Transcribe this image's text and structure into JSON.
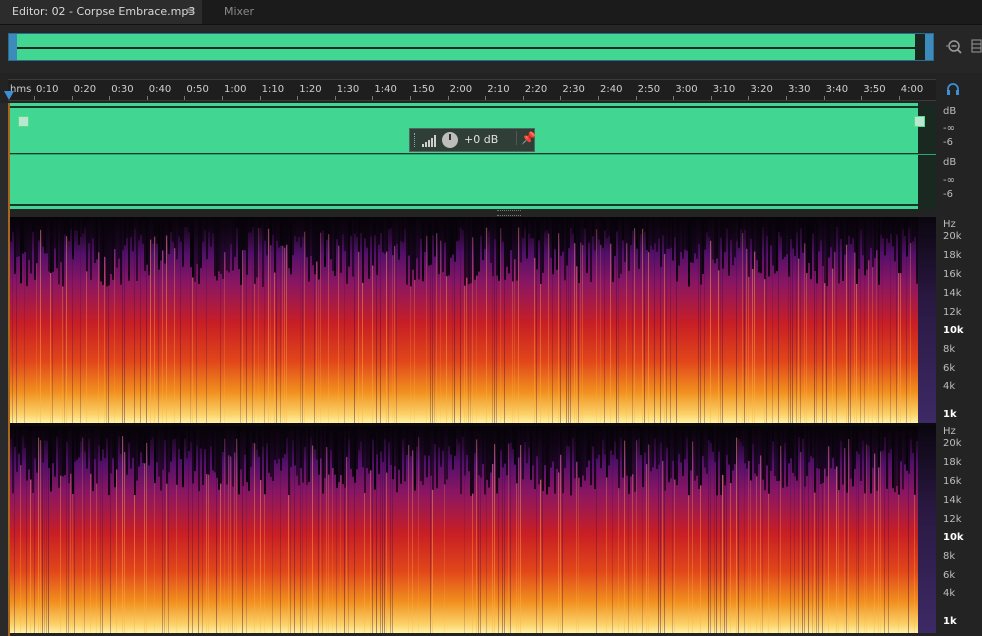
{
  "tabs": {
    "editor": "Editor: 02 - Corpse Embrace.mp3",
    "editor_menu": "≡",
    "mixer": "Mixer"
  },
  "ruler": {
    "unit": "hms",
    "labels": [
      "0:10",
      "0:20",
      "0:30",
      "0:40",
      "0:50",
      "1:00",
      "1:10",
      "1:20",
      "1:30",
      "1:40",
      "1:50",
      "2:00",
      "2:10",
      "2:20",
      "2:30",
      "2:40",
      "2:50",
      "3:00",
      "3:10",
      "3:20",
      "3:30",
      "3:40",
      "3:50",
      "4:00"
    ]
  },
  "hud": {
    "volume": "+0 dB"
  },
  "amplitude_scale": {
    "ch1": {
      "unit": "dB",
      "ticks": [
        "-∞",
        "-6"
      ]
    },
    "ch2": {
      "unit": "dB",
      "ticks": [
        "-∞",
        "-6"
      ]
    }
  },
  "spectral_scale": {
    "unit": "Hz",
    "ticks": [
      "20k",
      "18k",
      "16k",
      "14k",
      "12k",
      "10k",
      "8k",
      "6k",
      "4k",
      "1k"
    ],
    "bold": [
      "10k",
      "1k"
    ]
  },
  "colors": {
    "waveform": "#42d693",
    "accent": "#3d8fd6",
    "spectral_low": "#fff2a8",
    "spectral_mid": "#c81f24",
    "spectral_high": "#53106a"
  },
  "icons": {
    "zoom": "zoom-out-icon",
    "panel": "panel-menu-icon",
    "headphones": "headphones-icon",
    "pin": "pin-icon"
  }
}
